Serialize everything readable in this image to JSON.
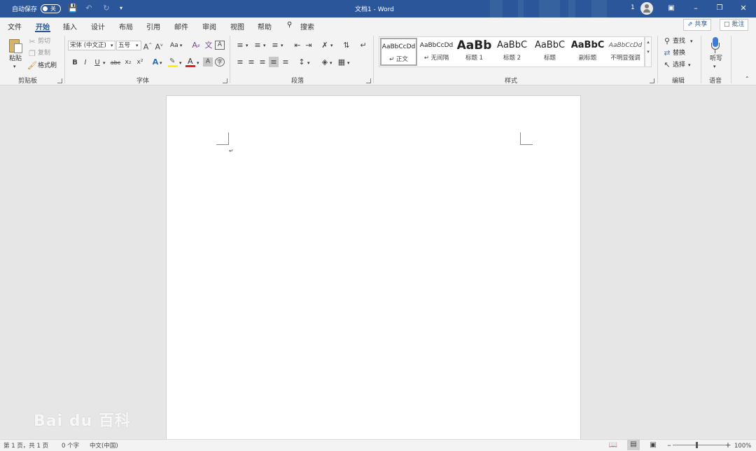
{
  "titlebar": {
    "autosave_label": "自动保存",
    "autosave_state": "关",
    "doc_title": "文档1 - Word",
    "user_number": "1",
    "bg_color": "#2b579a"
  },
  "tabs": [
    "文件",
    "开始",
    "插入",
    "设计",
    "布局",
    "引用",
    "邮件",
    "审阅",
    "视图",
    "帮助",
    "搜索"
  ],
  "active_tab": "开始",
  "header_buttons": {
    "share": "共享",
    "comments": "批注"
  },
  "ribbon": {
    "clipboard": {
      "paste": "粘贴",
      "cut": "剪切",
      "copy": "复制",
      "format_painter": "格式刷",
      "group": "剪贴板"
    },
    "font": {
      "font_name": "宋体 (中文正)",
      "font_size": "五号",
      "change_case": "Aa",
      "bold": "B",
      "italic": "I",
      "underline": "U",
      "strike": "abc",
      "subscript": "x₂",
      "superscript": "x²",
      "font_color_letter": "A",
      "group": "字体"
    },
    "paragraph": {
      "group": "段落"
    },
    "styles": {
      "group": "样式",
      "items": [
        {
          "preview": "AaBbCcDd",
          "name": "↵ 正文"
        },
        {
          "preview": "AaBbCcDd",
          "name": "↵ 无间隔"
        },
        {
          "preview": "AaBb",
          "name": "标题 1"
        },
        {
          "preview": "AaBbC",
          "name": "标题 2"
        },
        {
          "preview": "AaBbC",
          "name": "标题"
        },
        {
          "preview": "AaBbC",
          "name": "副标题"
        },
        {
          "preview": "AaBbCcDd",
          "name": "不明显强调"
        }
      ]
    },
    "editing": {
      "find": "查找",
      "replace": "替换",
      "select": "选择",
      "group": "编辑"
    },
    "voice": {
      "dictate": "听写",
      "group": "语音"
    }
  },
  "document": {
    "paragraph_mark": "↵"
  },
  "watermark": "Bai du 百科",
  "status": {
    "page": "第 1 页，共 1 页",
    "words": "0 个字",
    "language": "中文(中国)",
    "zoom": "100%"
  }
}
